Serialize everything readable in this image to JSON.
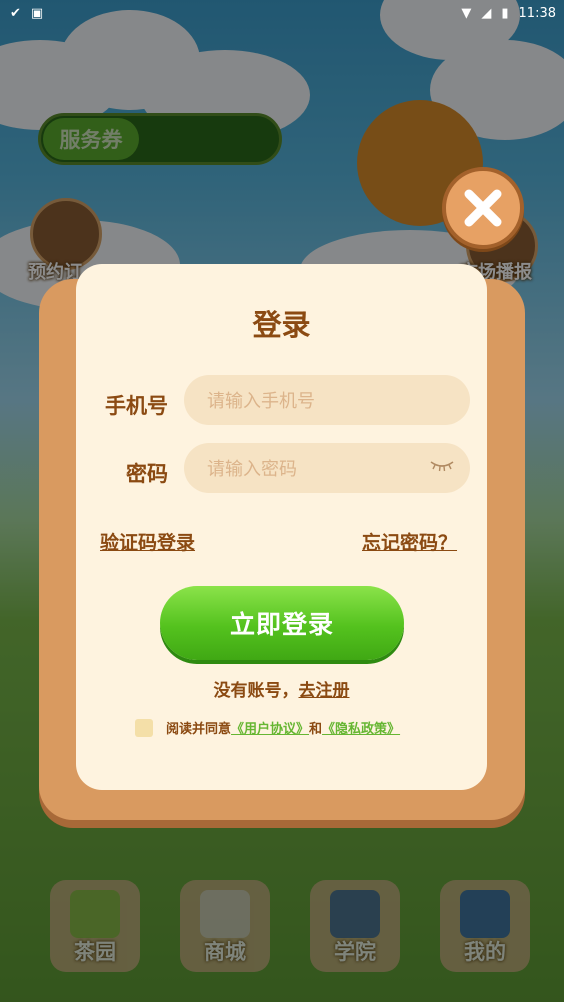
{
  "status": {
    "time": "11:38"
  },
  "background": {
    "service_pill": "服务券",
    "side_left_label": "预约订",
    "side_right_label": "市场播报"
  },
  "nav": [
    {
      "label": "茶园",
      "icon": "seedling-icon"
    },
    {
      "label": "商城",
      "icon": "shop-icon"
    },
    {
      "label": "学院",
      "icon": "books-icon"
    },
    {
      "label": "我的",
      "icon": "profile-book-icon"
    }
  ],
  "dialog": {
    "title": "登录",
    "phone_label": "手机号",
    "phone_placeholder": "请输入手机号",
    "password_label": "密码",
    "password_placeholder": "请输入密码",
    "code_login_link": "验证码登录",
    "forgot_link": "忘记密码？",
    "login_button": "立即登录",
    "no_account": "没有账号，",
    "register_link": "去注册",
    "agree_text": "阅读并同意",
    "user_agreement": "《用户协议》",
    "and_text": "和",
    "privacy_policy": "《隐私政策》"
  },
  "colors": {
    "accent_green": "#54c21e",
    "text_brown": "#8b4a12",
    "card_bg": "#fef3df"
  }
}
